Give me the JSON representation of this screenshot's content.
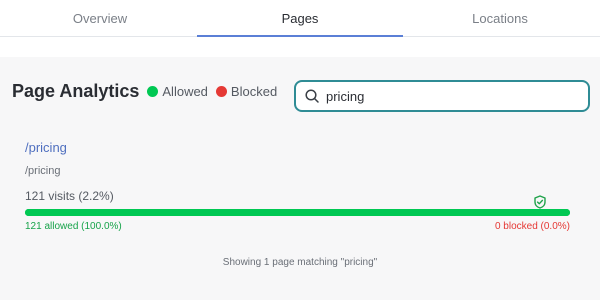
{
  "tabs": [
    {
      "label": "Overview",
      "active": false
    },
    {
      "label": "Pages",
      "active": true
    },
    {
      "label": "Locations",
      "active": false
    }
  ],
  "header": {
    "title": "Page Analytics",
    "legend": [
      {
        "label": "Allowed",
        "color": "#00c853"
      },
      {
        "label": "Blocked",
        "color": "#e53935"
      }
    ]
  },
  "search": {
    "value": "pricing",
    "icon": "search-icon"
  },
  "results": [
    {
      "title": "/pricing",
      "path": "/pricing",
      "visits_text": "121 visits (2.2%)",
      "allowed_fraction": 1.0,
      "allowed_text": "121 allowed (100.0%)",
      "blocked_text": "0 blocked (0.0%)",
      "status_icon": "shield-check-icon",
      "status_color": "#1fa24a"
    }
  ],
  "footer": {
    "summary": "Showing 1 page matching \"pricing\""
  },
  "colors": {
    "accent": "#5b7fd6",
    "search_border": "#2f8c95",
    "allowed": "#00c853",
    "blocked": "#e53935"
  }
}
